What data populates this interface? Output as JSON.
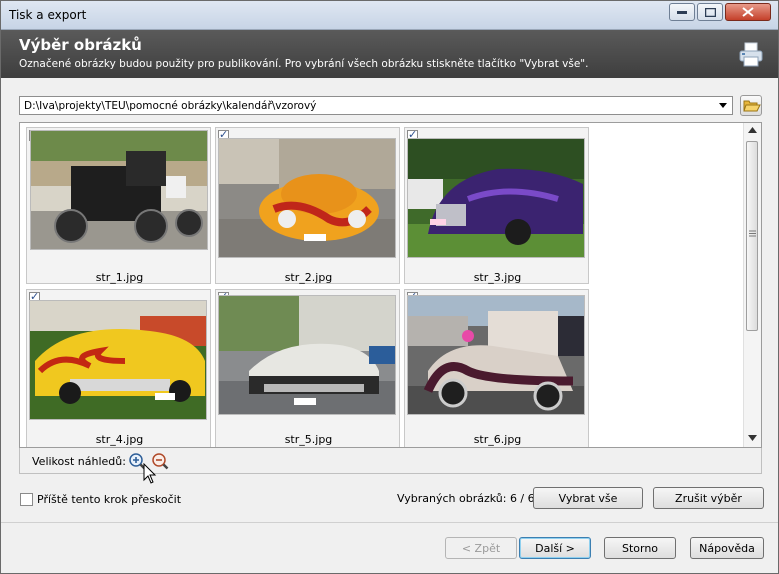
{
  "window": {
    "title": "Tisk a export"
  },
  "header": {
    "title": "Výběr obrázků",
    "subtitle": "Označené obrázky budou použity pro publikování. Pro vybrání všech obrázku stiskněte tlačítko \"Vybrat vše\"."
  },
  "path": {
    "value": "D:\\Iva\\projekty\\TEU\\pomocné obrázky\\kalendář\\vzorový"
  },
  "gallery": {
    "items": [
      {
        "filename": "str_1.jpg",
        "checked": true
      },
      {
        "filename": "str_2.jpg",
        "checked": true
      },
      {
        "filename": "str_3.jpg",
        "checked": true
      },
      {
        "filename": "str_4.jpg",
        "checked": true
      },
      {
        "filename": "str_5.jpg",
        "checked": true
      },
      {
        "filename": "str_6.jpg",
        "checked": true
      }
    ]
  },
  "zoom": {
    "label": "Velikost náhledů:"
  },
  "skip_step": {
    "label": "Příště tento krok přeskočit",
    "checked": false
  },
  "selection": {
    "count_text": "Vybraných obrázků: 6 / 6",
    "select_all": "Vybrat vše",
    "deselect": "Zrušit výběr"
  },
  "footer": {
    "back": "< Zpět",
    "next": "Další >",
    "cancel": "Storno",
    "help": "Nápověda"
  },
  "colors": {
    "header_bg": "#4a4a4a",
    "accent": "#3c7fb1"
  }
}
